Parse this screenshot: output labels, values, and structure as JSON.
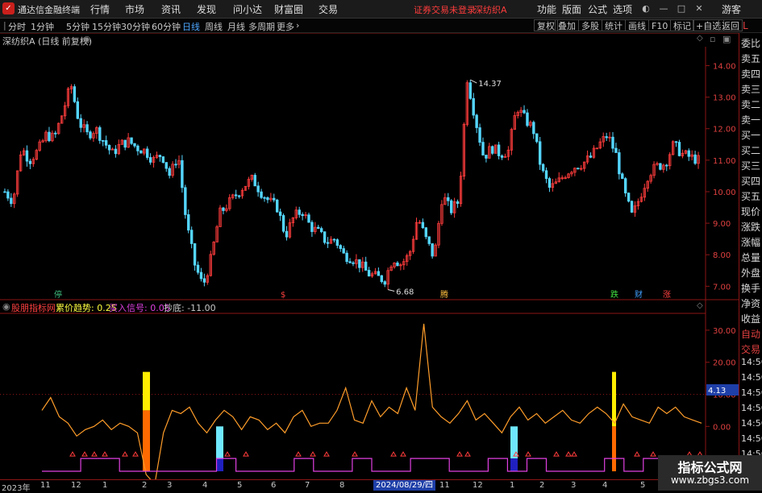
{
  "titlebar": {
    "app_name": "通达信金融终端",
    "menus": [
      "行情",
      "市场",
      "资讯",
      "发现",
      "问小达",
      "财富圈",
      "交易"
    ],
    "warning": "证券交易未登录",
    "stock": "深纺织A",
    "right_menus": [
      "功能",
      "版面",
      "公式",
      "选项"
    ],
    "user": "游客"
  },
  "periodbar": {
    "periods": [
      "分时",
      "1分钟",
      "5分钟",
      "15分钟",
      "30分钟",
      "60分钟",
      "日线",
      "周线",
      "月线",
      "多周期",
      "更多"
    ],
    "active": "日线",
    "tools": [
      "复权",
      "叠加",
      "多股",
      "统计",
      "画线",
      "F10",
      "标记",
      "+自选",
      "返回"
    ]
  },
  "chart_header": {
    "title": "深纺织A (日线 前复权)"
  },
  "side_panel": {
    "items": [
      "委比",
      "卖五",
      "卖四",
      "卖三",
      "卖二",
      "卖一",
      "买一",
      "买二",
      "买三",
      "买四",
      "买五",
      "现价",
      "涨跌",
      "涨幅",
      "总量",
      "外盘",
      "换手",
      "净资",
      "收益",
      "自动",
      "交易"
    ],
    "times": [
      "14:56",
      "14:56",
      "14:56",
      "14:56",
      "14:56",
      "14:56",
      "14:56",
      "14:56",
      "14:56"
    ]
  },
  "indicator": {
    "name": "股朋指标网",
    "labels": [
      {
        "text": "累价趋势: 0.25",
        "color": "#ff4040"
      },
      {
        "text": "买入信号: 0.05",
        "color": "#ffff40"
      },
      {
        "text": "抄底: -11.00",
        "color": "#e040e0"
      }
    ],
    "value_box": "4.13"
  },
  "chart_data": [
    {
      "type": "candlestick",
      "title": "深纺织A (日线 前复权)",
      "ylim": [
        6.6,
        14.6
      ],
      "y_ticks": [
        7.0,
        8.0,
        9.0,
        10.0,
        11.0,
        12.0,
        13.0,
        14.0
      ],
      "high_annotation": "14.37",
      "low_annotation": "6.68",
      "y_path": [
        10.0,
        9.7,
        11.4,
        11.0,
        11.3,
        11.8,
        11.7,
        12.5,
        13.4,
        12.2,
        11.8,
        12.0,
        11.6,
        11.2,
        11.5,
        11.6,
        11.4,
        11.3,
        11.0,
        11.2,
        10.5,
        11.2,
        9.0,
        7.7,
        7.0,
        7.9,
        9.3,
        9.6,
        9.9,
        10.2,
        10.4,
        10.0,
        9.7,
        9.5,
        8.6,
        9.2,
        9.4,
        8.9,
        8.7,
        8.4,
        8.5,
        8.0,
        7.9,
        7.7,
        7.4,
        7.3,
        7.2,
        7.9,
        7.7,
        8.0,
        9.2,
        8.5,
        7.9,
        9.9,
        9.4,
        9.7,
        13.6,
        12.3,
        11.1,
        11.4,
        11.2,
        11.3,
        12.7,
        12.3,
        12.0,
        10.7,
        10.1,
        10.3,
        10.6,
        10.8,
        10.9,
        11.1,
        11.5,
        11.8,
        11.2,
        10.0,
        9.2,
        9.9,
        10.6,
        10.8,
        10.9,
        11.5,
        11.2,
        11.1,
        11.0
      ],
      "signals": [
        {
          "text": "停",
          "color": "#40c080"
        },
        {
          "text": "$",
          "color": "#ff4040"
        },
        {
          "text": "腾",
          "color": "#ffc040"
        },
        {
          "text": "跌",
          "color": "#40e040"
        },
        {
          "text": "财",
          "color": "#40a0ff"
        },
        {
          "text": "涨",
          "color": "#ff4040"
        }
      ]
    },
    {
      "type": "line",
      "ylim": [
        -16,
        35
      ],
      "y_ticks": [
        30.0,
        20.0,
        10.0,
        0.0,
        -10.0
      ],
      "series": [
        {
          "values": [
            5,
            9,
            3,
            1,
            -3,
            -1,
            0,
            2,
            -1,
            1,
            0,
            -2,
            -15,
            -18,
            -2,
            5,
            4,
            6,
            1,
            -2,
            2,
            5,
            3,
            -1,
            3,
            2,
            -1,
            1,
            -2,
            3,
            5,
            0,
            1,
            1,
            5,
            12,
            2,
            1,
            8,
            3,
            6,
            4,
            12,
            5,
            32,
            6,
            3,
            1,
            4,
            8,
            2,
            4,
            1,
            -2,
            3,
            6,
            2,
            4,
            1,
            3,
            5,
            2,
            1,
            4,
            6,
            4,
            1,
            7,
            3,
            2,
            1,
            6,
            4,
            6,
            3,
            2,
            1
          ]
        },
        {
          "values": [
            -14,
            -14,
            -10,
            -10,
            -14,
            -14,
            -14,
            -14,
            -14,
            -10,
            -14,
            -14,
            -14,
            -10,
            -14,
            -14,
            -10,
            -14,
            -14,
            -10,
            -10,
            -14,
            -14,
            -10,
            -14,
            -10,
            -14,
            -14,
            -14,
            -10,
            -14,
            -10,
            -14,
            -14,
            -14
          ]
        }
      ]
    }
  ],
  "x_axis": {
    "labels": [
      "2023年",
      "11",
      "12",
      "1",
      "2",
      "3",
      "4",
      "5",
      "6",
      "7",
      "8",
      "2024/08/29/四",
      "11",
      "12",
      "1",
      "2",
      "3",
      "4",
      "5",
      "6"
    ],
    "highlight": "2024/08/29/四"
  },
  "watermark": {
    "line1": "指标公式网",
    "line2": "www.zbgs3.com"
  }
}
